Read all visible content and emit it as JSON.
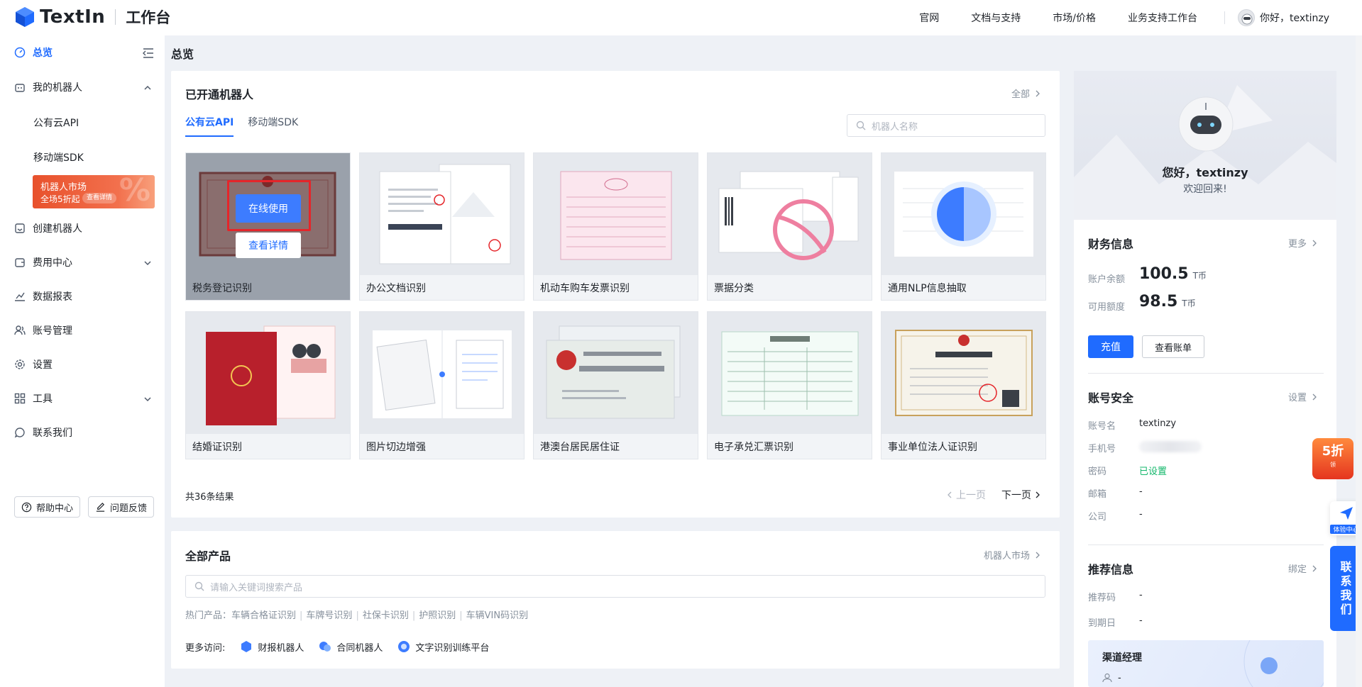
{
  "header": {
    "brand": "TextIn",
    "subtitle": "工作台",
    "nav": [
      "官网",
      "文档与支持",
      "市场/价格",
      "业务支持工作台"
    ],
    "user_greeting": "你好，textinzy"
  },
  "sidebar": {
    "overview": "总览",
    "my_robots": "我的机器人",
    "public_api": "公有云API",
    "mobile_sdk": "移动端SDK",
    "market_title": "机器人市场",
    "market_sub": "全场5折起",
    "market_pill": "查看详情",
    "market_pct": "%",
    "create_robot": "创建机器人",
    "fee_center": "费用中心",
    "reports": "数据报表",
    "account_mgmt": "账号管理",
    "settings": "设置",
    "tools": "工具",
    "contact_us": "联系我们",
    "help_center": "帮助中心",
    "feedback": "问题反馈"
  },
  "page": {
    "title": "总览"
  },
  "opened_robots": {
    "title": "已开通机器人",
    "all_link": "全部",
    "tabs": [
      "公有云API",
      "移动端SDK"
    ],
    "search_placeholder": "机器人名称",
    "items": [
      "税务登记识别",
      "办公文档识别",
      "机动车购车发票识别",
      "票据分类",
      "通用NLP信息抽取",
      "结婚证识别",
      "图片切边增强",
      "港澳台居民居住证",
      "电子承兑汇票识别",
      "事业单位法人证识别"
    ],
    "hover_online": "在线使用",
    "hover_detail": "查看详情",
    "total": "共36条结果",
    "prev": "上一页",
    "next": "下一页"
  },
  "all_products": {
    "title": "全部产品",
    "market_link": "机器人市场",
    "search_placeholder": "请输入关键词搜索产品",
    "hot_label": "热门产品：",
    "hot": [
      "车辆合格证识别",
      "车牌号识别",
      "社保卡识别",
      "护照识别",
      "车辆VIN码识别"
    ],
    "more_label": "更多访问:",
    "more": [
      "财报机器人",
      "合同机器人",
      "文字识别训练平台"
    ]
  },
  "profile": {
    "greeting": "您好，textinzy",
    "welcome": "欢迎回来!"
  },
  "finance": {
    "title": "财务信息",
    "more": "更多",
    "balance_label": "账户余额",
    "balance": "100.5",
    "quota_label": "可用额度",
    "quota": "98.5",
    "unit": "T币",
    "recharge": "充值",
    "bill": "查看账单"
  },
  "security": {
    "title": "账号安全",
    "settings": "设置",
    "username_label": "账号名",
    "username": "textinzy",
    "phone_label": "手机号",
    "password_label": "密码",
    "password": "已设置",
    "email_label": "邮箱",
    "email": "-",
    "company_label": "公司",
    "company": "-"
  },
  "referral": {
    "title": "推荐信息",
    "bind": "绑定",
    "code_label": "推荐码",
    "code": "-",
    "expire_label": "到期日",
    "expire": "-",
    "channel_title": "渠道经理",
    "channel_value": "-"
  },
  "floating": {
    "promo_big": "5折",
    "promo_small": "领",
    "experience": "体验中心",
    "contact": [
      "联",
      "系",
      "我",
      "们"
    ]
  },
  "colors": {
    "accent": "#1f6bff",
    "promo": "#e8512c",
    "success": "#12b76a"
  }
}
